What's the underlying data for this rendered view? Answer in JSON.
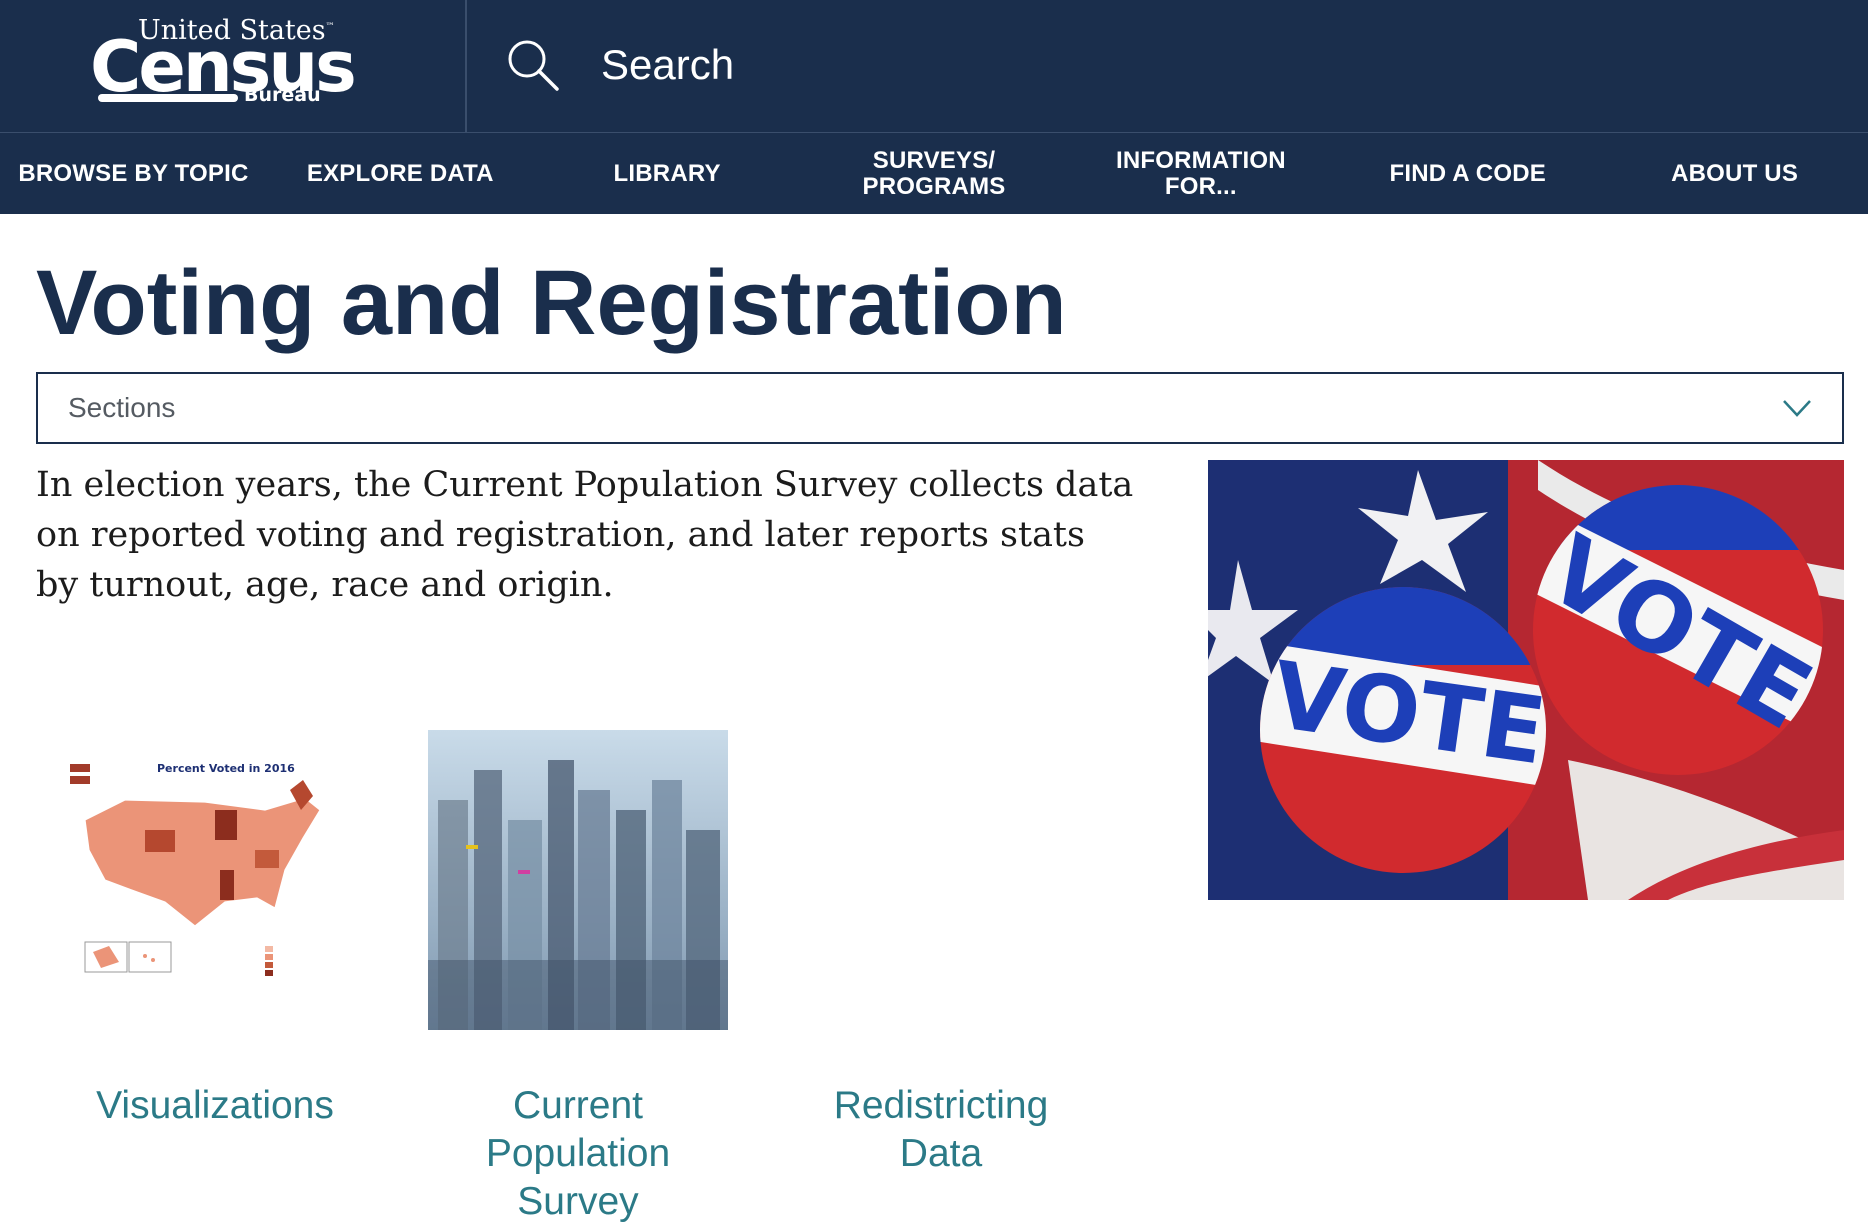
{
  "header": {
    "logo": {
      "top": "United States",
      "tm": "™",
      "main": "Census",
      "bureau": "Bureau"
    },
    "search": {
      "label": "Search",
      "icon": "search-icon"
    }
  },
  "nav": {
    "items": [
      {
        "label": "BROWSE BY TOPIC",
        "lines": [
          "BROWSE BY TOPIC"
        ]
      },
      {
        "label": "EXPLORE DATA",
        "lines": [
          "EXPLORE DATA"
        ]
      },
      {
        "label": "LIBRARY",
        "lines": [
          "LIBRARY"
        ]
      },
      {
        "label": "SURVEYS/ PROGRAMS",
        "lines": [
          "SURVEYS/",
          "PROGRAMS"
        ]
      },
      {
        "label": "INFORMATION FOR...",
        "lines": [
          "INFORMATION",
          "FOR..."
        ]
      },
      {
        "label": "FIND A CODE",
        "lines": [
          "FIND A CODE"
        ]
      },
      {
        "label": "ABOUT US",
        "lines": [
          "ABOUT US"
        ]
      }
    ]
  },
  "main": {
    "title": "Voting and Registration",
    "sections_select": {
      "label": "Sections",
      "icon": "chevron-down-icon"
    },
    "intro": "In election years, the Current Population Survey collects data on reported voting and registration, and later reports stats by turnout, age, race and origin.",
    "hero_image": {
      "button_text_1": "VOTE",
      "button_text_2": "VOTE"
    },
    "cards": [
      {
        "label": "Visualizations",
        "thumb_title": "Percent Voted in 2016"
      },
      {
        "label": "Current Population Survey"
      },
      {
        "label": "Redistricting Data"
      }
    ]
  },
  "colors": {
    "navy": "#1a2e4c",
    "teal_link": "#2b7a87",
    "white": "#ffffff"
  }
}
